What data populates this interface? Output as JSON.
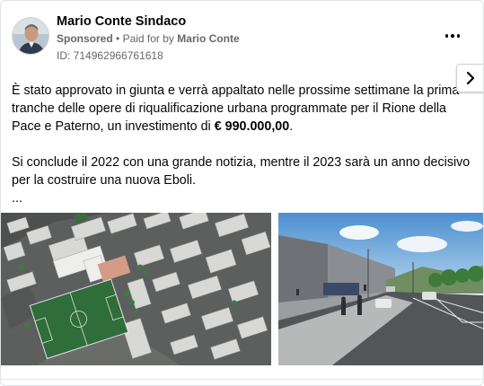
{
  "post": {
    "author": "Mario Conte Sindaco",
    "sponsored_label": "Sponsored",
    "separator": "•",
    "paid_for_prefix": "Paid for by",
    "payer": "Mario Conte",
    "ad_id": "ID: 714962966761618",
    "paragraph1_text": "È stato approvato in giunta e verrà appaltato nelle prossime settimane la prima tranche delle opere di riqualificazione urbana programmate per il Rione della Pace e Paterno, un investimento di ",
    "paragraph1_amount": "€ 990.000,00",
    "paragraph1_end": ".",
    "paragraph2": "Si conclude il 2022 con una grande notizia, mentre il 2023 sarà un anno decisivo per la costruire una nuova Eboli.",
    "truncation": "...",
    "icons": {
      "more": "more-horizontal-icon",
      "next": "chevron-right-icon"
    }
  }
}
